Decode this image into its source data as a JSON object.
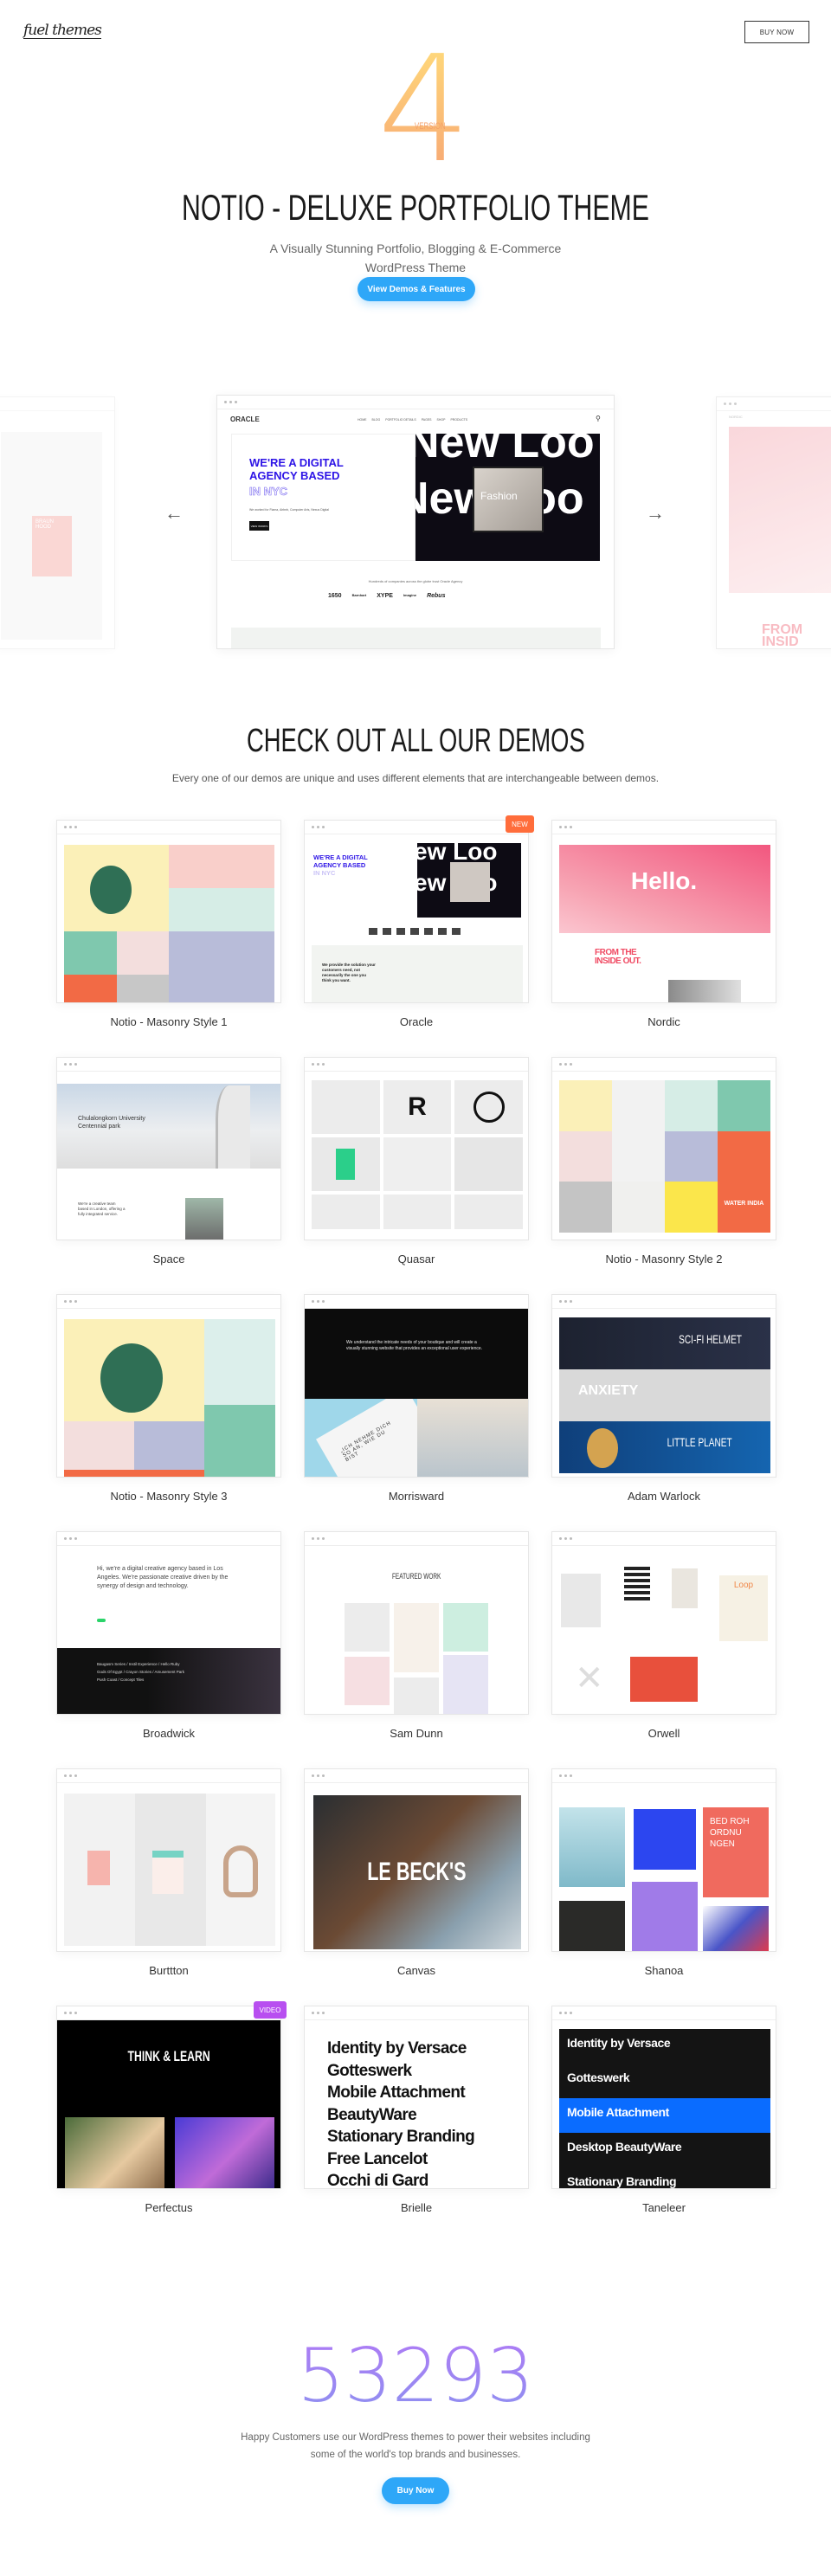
{
  "header": {
    "logo": "fuel themes",
    "buy_label": "BUY NOW"
  },
  "hero": {
    "version_number": "4",
    "version_label": "VERSION",
    "title": "NOTIO - DELUXE PORTFOLIO THEME",
    "subtitle_line1": "A Visually Stunning Portfolio, Blogging & E-Commerce",
    "subtitle_line2": "WordPress Theme",
    "cta_label": "View Demos & Features",
    "accent": "#2ea7f8"
  },
  "carousel": {
    "prev_icon": "arrow-left-icon",
    "next_icon": "arrow-right-icon",
    "center": {
      "logo": "ORACLE",
      "nav": [
        "HOME",
        "BLOG",
        "PORTFOLIO DETAILS",
        "PAGES",
        "SHOP",
        "PRODUCTS"
      ],
      "headline1": "WE'RE A DIGITAL",
      "headline2": "AGENCY BASED",
      "headline3": "IN NYC",
      "tagline": "We worked for Fiama, Airbnb, Computer Arts, Nexus Digital",
      "button": "VIEW WORKS",
      "bg_text": "New Loo",
      "photo_caption": "Fashion",
      "trust": "Hundreds of companies across the globe trust Oracle Agency",
      "clients": [
        "1650",
        "Barnhart",
        "XYPE",
        "Imagine",
        "Rebus"
      ]
    },
    "right": {
      "logo": "NORDIC",
      "headline": "FROM INSID"
    },
    "left": {
      "headline": "BRAUN HOOD"
    }
  },
  "demos_section": {
    "title": "CHECK OUT ALL OUR DEMOS",
    "subtitle": "Every one of our demos are unique and uses different elements that are interchangeable between demos."
  },
  "demos": [
    {
      "name": "Notio - Masonry Style 1"
    },
    {
      "name": "Oracle",
      "badge": "NEW",
      "badge_color": "#ff6d3b",
      "h1": "WE'RE A DIGITAL",
      "h2": "AGENCY BASED",
      "h3": "IN NYC",
      "bg_text": "ew Loo",
      "body": "We provide the solution your customers need, not necessarily the one you think you want."
    },
    {
      "name": "Nordic",
      "hero": "Hello.",
      "h1": "FROM THE",
      "h2": "INSIDE OUT."
    },
    {
      "name": "Space",
      "h1": "Chulalongkorn University",
      "h2": "Centennial park",
      "body": "We're a creative team based in London, offering a fully integrated service."
    },
    {
      "name": "Quasar",
      "tile": "R"
    },
    {
      "name": "Notio - Masonry Style 2",
      "tile": "WATER INDIA"
    },
    {
      "name": "Notio - Masonry Style 3"
    },
    {
      "name": "Morrisward",
      "body": "We understand the intricate needs of your boutique and will create a visually stunning website that provides an exceptional user experience.",
      "card_text": "„ICH NEHME DICH SO AN, WIE DU BIST"
    },
    {
      "name": "Adam Warlock",
      "b1": "SCI-FI HELMET",
      "b2": "ANXIETY",
      "b3": "LITTLE PLANET"
    },
    {
      "name": "Broadwick",
      "body": "Hi, we're a digital creative agency based in Los Angeles. We're passionate creative driven by the synergy of design and technology.",
      "list1": "Baugasm Series / Instil Experience / Hello Ruby",
      "list2": "Gods Of Egypt / Crayon Stories / Amusement Park",
      "list3": "Push Coast / Concept Tiles"
    },
    {
      "name": "Sam Dunn",
      "h1": "FEATURED WORK"
    },
    {
      "name": "Orwell",
      "tile": "Loop"
    },
    {
      "name": "Burttton"
    },
    {
      "name": "Canvas",
      "hero": "LE BECK'S"
    },
    {
      "name": "Shanoa",
      "tile": "BED ROH ORDNU NGEN"
    },
    {
      "name": "Perfectus",
      "badge": "VIDEO",
      "badge_color": "#b84ff0",
      "hero": "THINK & LEARN"
    },
    {
      "name": "Brielle",
      "items": [
        "Identity by Versace",
        "Gotteswerk",
        "Mobile Attachment",
        "BeautyWare",
        "Stationary Branding",
        "Free Lancelot",
        "Occhi di Gard"
      ]
    },
    {
      "name": "Taneleer",
      "items": [
        "Identity by Versace",
        "Gotteswerk",
        "Mobile Attachment",
        "Desktop BeautyWare",
        "Stationary Branding"
      ],
      "highlight": "#0a6cff"
    }
  ],
  "stats": {
    "count": "53293",
    "text_line1": "Happy Customers use our WordPress themes to power their websites including",
    "text_line2": "some of the world's top brands and businesses.",
    "cta_label": "Buy Now"
  }
}
